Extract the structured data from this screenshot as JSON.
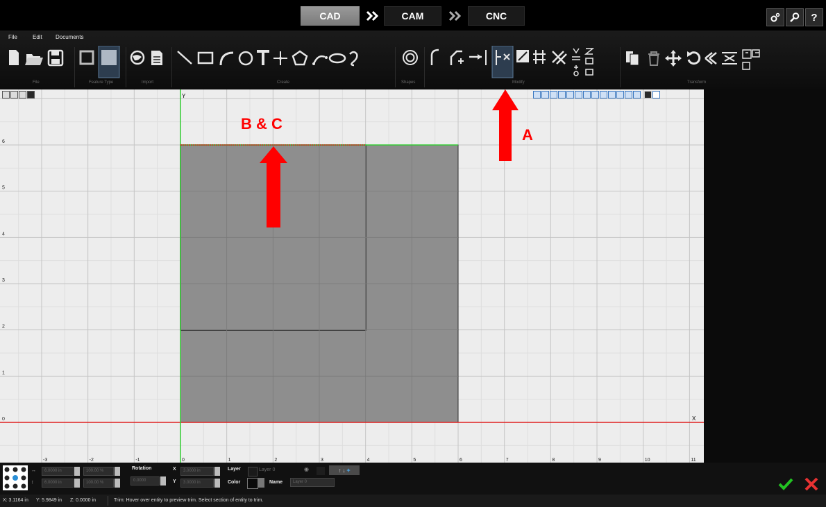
{
  "modes": [
    {
      "label": "CAD",
      "active": true
    },
    {
      "label": "CAM",
      "active": false
    },
    {
      "label": "CNC",
      "active": false
    }
  ],
  "top_icons": [
    "settings-icon",
    "search-icon",
    "help-icon"
  ],
  "help_label": "?",
  "menu": [
    "File",
    "Edit",
    "Documents"
  ],
  "ribbon_groups": [
    "File",
    "Feature Type",
    "Import",
    "Create",
    "Shapes",
    "Modify",
    "Transform"
  ],
  "canvas": {
    "x_ticks": [
      "-3",
      "-2",
      "-1",
      "0",
      "1",
      "2",
      "3",
      "4",
      "5",
      "6",
      "7",
      "8",
      "9",
      "10",
      "11"
    ],
    "y_ticks": [
      "0",
      "1",
      "2",
      "3",
      "4",
      "5",
      "6"
    ],
    "x_axis_label": "X",
    "y_axis_label": "Y"
  },
  "annotations": {
    "a": "A",
    "bc": "B & C"
  },
  "bottom": {
    "width_value": "6.0000 in",
    "height_value": "6.0000 in",
    "scale_w": "100.00 %",
    "scale_h": "100.00 %",
    "rotation_label": "Rotation",
    "rotation_value": "0.0000",
    "x_label": "X",
    "y_label": "Y",
    "x_value": "3.0000 in",
    "y_value": "3.0000 in",
    "layer_label": "Layer",
    "layer_value": "Layer 0",
    "color_label": "Color",
    "name_label": "Name",
    "name_placeholder": "Layer 0"
  },
  "status": {
    "x": "X: 3.1164 in",
    "y": "Y: 5.9849 in",
    "z": "Z: 0.0000 in",
    "message": "Trim: Hover over entity to preview trim.  Select section of entity to trim."
  },
  "colors": {
    "accent_green": "#22c322",
    "cancel_red": "#e83232",
    "axis_red": "#e02020",
    "axis_green": "#33cc33",
    "annotation_red": "#ff0000"
  }
}
